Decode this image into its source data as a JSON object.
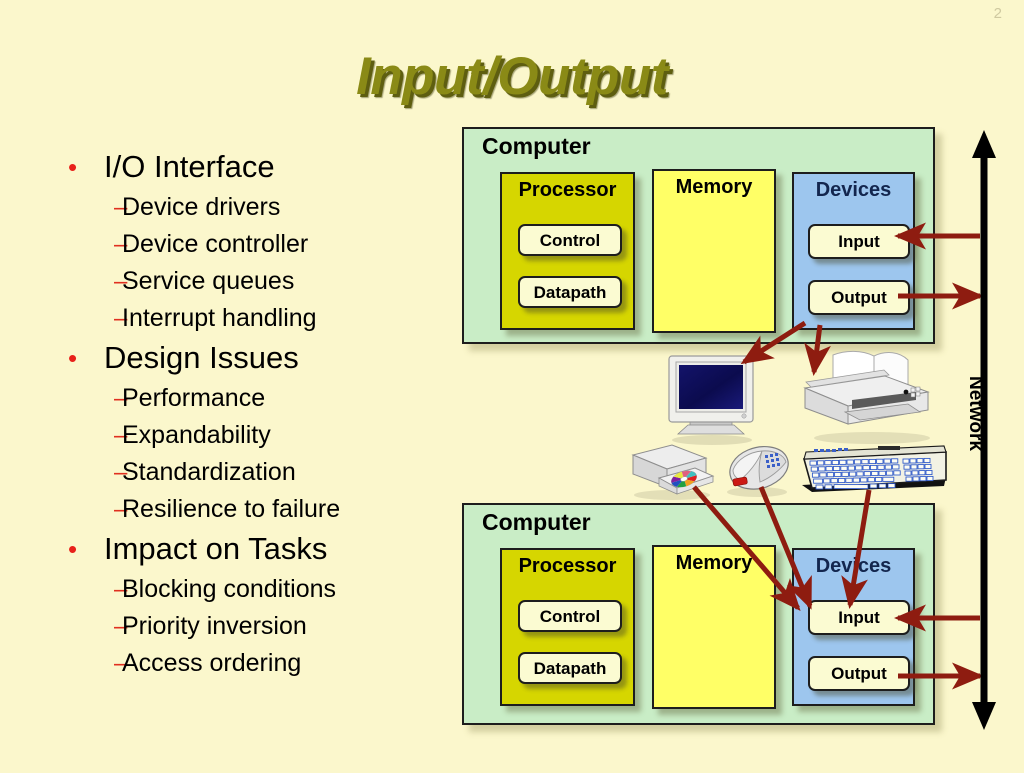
{
  "slide": {
    "number": "2",
    "title": "Input/Output",
    "background_color": "#FBF7CC",
    "title_color": "#8A8A16"
  },
  "bullets": [
    {
      "level": 1,
      "marker": "•",
      "text": "I/O Interface"
    },
    {
      "level": 2,
      "marker": "–",
      "text": "Device drivers"
    },
    {
      "level": 2,
      "marker": "–",
      "text": "Device controller"
    },
    {
      "level": 2,
      "marker": "–",
      "text": "Service queues"
    },
    {
      "level": 2,
      "marker": "–",
      "text": "Interrupt handling"
    },
    {
      "level": 1,
      "marker": "•",
      "text": "Design Issues"
    },
    {
      "level": 2,
      "marker": "–",
      "text": "Performance"
    },
    {
      "level": 2,
      "marker": "–",
      "text": "Expandability"
    },
    {
      "level": 2,
      "marker": "–",
      "text": "Standardization"
    },
    {
      "level": 2,
      "marker": "–",
      "text": "Resilience to failure"
    },
    {
      "level": 1,
      "marker": "•",
      "text": "Impact on Tasks"
    },
    {
      "level": 2,
      "marker": "–",
      "text": "Blocking conditions"
    },
    {
      "level": 2,
      "marker": "–",
      "text": "Priority inversion"
    },
    {
      "level": 2,
      "marker": "–",
      "text": "Access ordering"
    }
  ],
  "diagram": {
    "computer_top": {
      "label": "Computer",
      "processor": {
        "label": "Processor",
        "color": "#D6D600",
        "control": "Control",
        "datapath": "Datapath"
      },
      "memory": {
        "label": "Memory",
        "color": "#FFFF66"
      },
      "devices": {
        "label": "Devices",
        "color": "#9DC6EE",
        "input": "Input",
        "output": "Output"
      }
    },
    "computer_bottom": {
      "label": "Computer",
      "processor": {
        "label": "Processor",
        "color": "#D6D600",
        "control": "Control",
        "datapath": "Datapath"
      },
      "memory": {
        "label": "Memory",
        "color": "#FFFF66"
      },
      "devices": {
        "label": "Devices",
        "color": "#9DC6EE",
        "input": "Input",
        "output": "Output"
      }
    },
    "network": {
      "label": "Network",
      "color": "#000000",
      "direction": "bidirectional"
    },
    "arrow_color": "#8E1C10",
    "peripherals": [
      {
        "name": "monitor-device",
        "kind": "output"
      },
      {
        "name": "printer-device",
        "kind": "output"
      },
      {
        "name": "disk-drive-device",
        "kind": "input"
      },
      {
        "name": "mouse-device",
        "kind": "input"
      },
      {
        "name": "keyboard-device",
        "kind": "input"
      }
    ]
  }
}
